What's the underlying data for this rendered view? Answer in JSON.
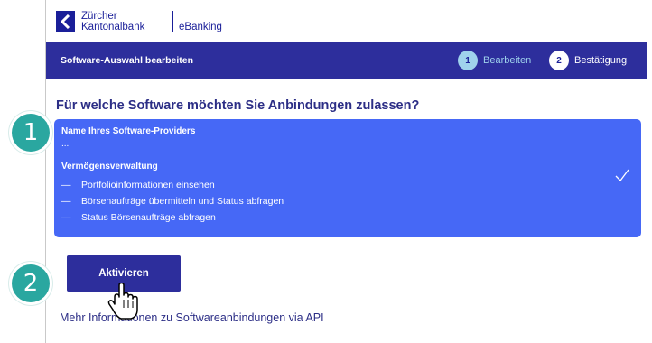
{
  "header": {
    "bank_name": "Zürcher\nKantonalbank",
    "app_name": "eBanking"
  },
  "topbar": {
    "title": "Software-Auswahl bearbeiten",
    "steps": [
      {
        "num": "1",
        "label": "Bearbeiten",
        "active": true
      },
      {
        "num": "2",
        "label": "Bestätigung",
        "active": false
      }
    ]
  },
  "main": {
    "question": "Für welche Software möchten Sie Anbindungen zulassen?",
    "card": {
      "provider_label": "Name Ihres Software-Providers",
      "provider_value": "...",
      "section_title": "Vermögensverwaltung",
      "items": [
        "Portfolioinformationen einsehen",
        "Börsenaufträge übermitteln und Status abfragen",
        "Status Börsenaufträge abfragen"
      ],
      "dash": "—",
      "selected": true
    },
    "button_label": "Aktivieren",
    "link_text": "Mehr Informationen zu Softwareanbindungen via API"
  },
  "annotations": {
    "badge1": "1",
    "badge2": "2"
  },
  "colors": {
    "brand": "#2d2e9c",
    "card": "#4668f6",
    "step_active": "#9fd2ec",
    "badge": "#2aa7a0"
  },
  "icons": {
    "logo": "zkb-logo-icon",
    "check": "checkmark-icon",
    "cursor": "hand-pointer-icon"
  }
}
